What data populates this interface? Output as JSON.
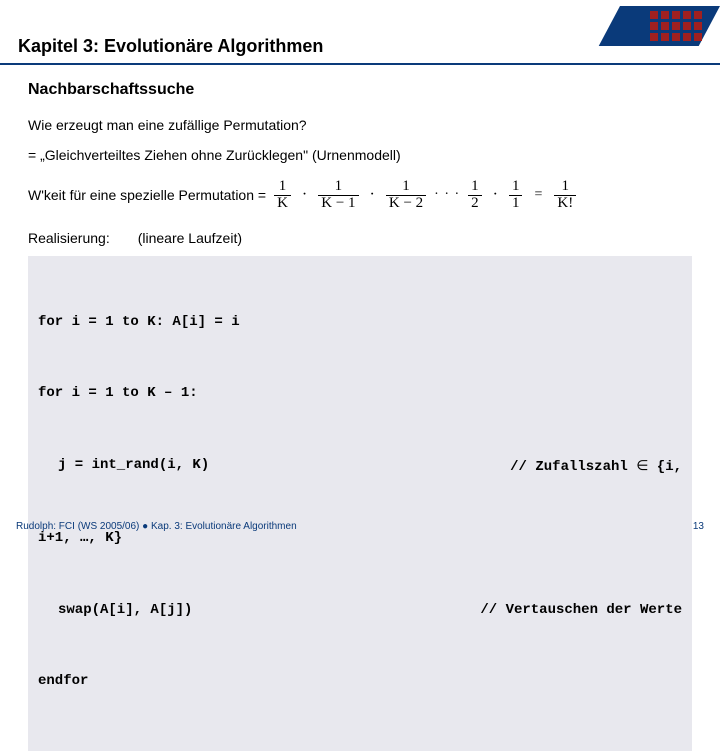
{
  "header": {
    "chapter_title": "Kapitel 3: Evolutionäre Algorithmen"
  },
  "section": {
    "title": "Nachbarschaftssuche",
    "question": "Wie erzeugt man eine zufällige Permutation?",
    "definition": "= „Gleichverteiltes Ziehen ohne Zurücklegen\" (Urnenmodell)",
    "prob_label": "W'keit für eine spezielle Permutation =",
    "probability": {
      "terms": [
        {
          "num": "1",
          "den": "K"
        },
        {
          "num": "1",
          "den": "K − 1"
        },
        {
          "num": "1",
          "den": "K − 2"
        }
      ],
      "tail_terms": [
        {
          "num": "1",
          "den": "2"
        },
        {
          "num": "1",
          "den": "1"
        }
      ],
      "result": {
        "num": "1",
        "den": "K!"
      },
      "ellipsis": "· · ·",
      "dot": "·",
      "equals": "="
    },
    "realization_label": "Realisierung:",
    "realization_note": "(lineare Laufzeit)"
  },
  "code": {
    "line1": "for i = 1 to K: A[i] = i",
    "line2": "for i = 1 to K – 1:",
    "line3_code": "j = int_rand(i, K)",
    "line3_comment": "// Zufallszahl ∈ {i, i+1, …, K}",
    "line3b": "i+1, …, K}",
    "line4_code": "swap(A[i], A[j])",
    "line4_comment": "// Vertauschen der Werte",
    "line5": "endfor"
  },
  "footer": {
    "left": "Rudolph: FCI (WS 2005/06) ● Kap. 3: Evolutionäre Algorithmen",
    "right": "13"
  }
}
